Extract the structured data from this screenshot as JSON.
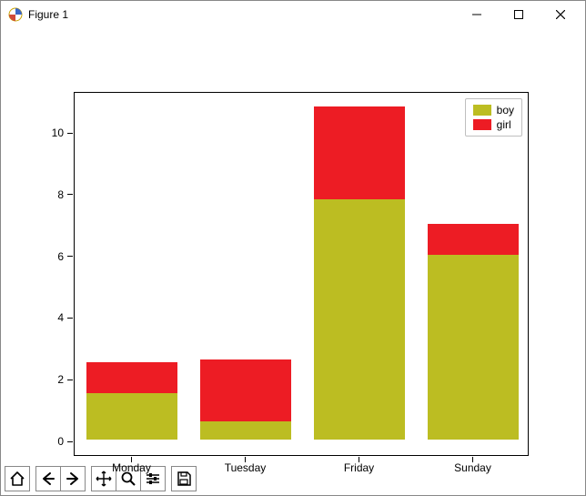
{
  "window": {
    "title": "Figure 1"
  },
  "chart_data": {
    "type": "bar",
    "stacked": true,
    "categories": [
      "Monday",
      "Tuesday",
      "Friday",
      "Sunday"
    ],
    "series": [
      {
        "name": "boy",
        "values": [
          1.5,
          0.6,
          7.8,
          6.0
        ],
        "color": "#bcbd22"
      },
      {
        "name": "girl",
        "values": [
          1.0,
          2.0,
          3.0,
          1.0
        ],
        "color": "#ed1c24"
      }
    ],
    "xlabel": "",
    "ylabel": "",
    "yticks": [
      0,
      2,
      4,
      6,
      8,
      10
    ],
    "ylim": [
      -0.5,
      11.3
    ],
    "xlim": [
      -0.5,
      3.5
    ],
    "bar_width": 0.8,
    "legend_loc": "upper right"
  }
}
